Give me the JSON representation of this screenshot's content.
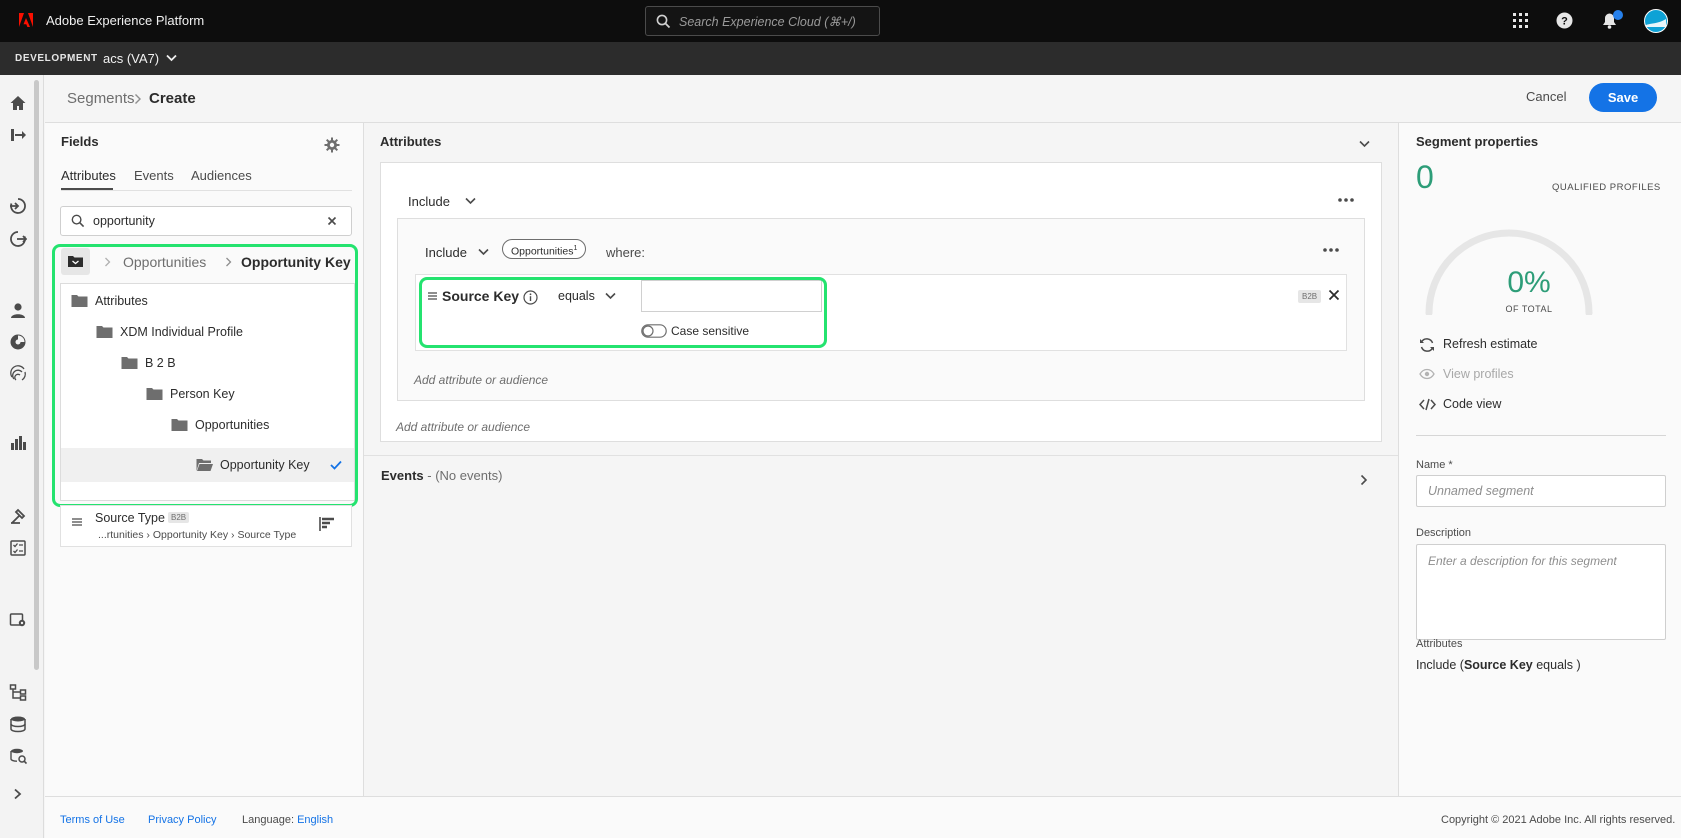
{
  "app": {
    "title": "Adobe Experience Platform"
  },
  "topbar": {
    "search_placeholder": "Search Experience Cloud (⌘+/)"
  },
  "envbar": {
    "environment": "DEVELOPMENT",
    "sandbox": "acs (VA7)"
  },
  "breadcrumb": {
    "parent": "Segments",
    "current": "Create"
  },
  "actions": {
    "cancel_label": "Cancel",
    "save_label": "Save"
  },
  "fields": {
    "title": "Fields",
    "tabs": [
      "Attributes",
      "Events",
      "Audiences"
    ],
    "search_value": "opportunity",
    "path": [
      "Opportunities",
      "Opportunity Key"
    ],
    "tree": [
      "Attributes",
      "XDM Individual Profile",
      "B 2 B",
      "Person Key",
      "Opportunities",
      "Opportunity Key"
    ],
    "result": {
      "name": "Source Type",
      "badge": "B2B",
      "path": "...rtunities › Opportunity Key › Source Type"
    }
  },
  "builder": {
    "attributes_title": "Attributes",
    "include_label": "Include",
    "inner_include_label": "Include",
    "chip_label": "Opportunities",
    "chip_count": "1",
    "where_label": "where:",
    "rule": {
      "field": "Source Key",
      "operator": "equals",
      "value": "",
      "case_label": "Case sensitive",
      "badge": "B2B"
    },
    "add_inner": "Add attribute or audience",
    "add_outer": "Add attribute or audience",
    "events_title": "Events",
    "events_sub": "- (No events)"
  },
  "properties": {
    "title": "Segment properties",
    "qualified_count": "0",
    "qualified_label": "QUALIFIED PROFILES",
    "percent": "0%",
    "of_total": "OF TOTAL",
    "refresh": "Refresh estimate",
    "view_profiles": "View profiles",
    "code_view": "Code view",
    "name_label": "Name *",
    "name_placeholder": "Unnamed segment",
    "desc_label": "Description",
    "desc_placeholder": "Enter a description for this segment",
    "attr_label": "Attributes",
    "attr_prefix": "Include (",
    "attr_field": "Source Key",
    "attr_suffix": " equals )"
  },
  "footer": {
    "terms": "Terms of Use",
    "privacy": "Privacy Policy",
    "language_label": "Language:",
    "language": "English",
    "copyright": "Copyright © 2021 Adobe Inc. All rights reserved."
  },
  "colors": {
    "accent": "#1473e6",
    "highlight": "#24e36f",
    "success": "#2d9d78"
  }
}
